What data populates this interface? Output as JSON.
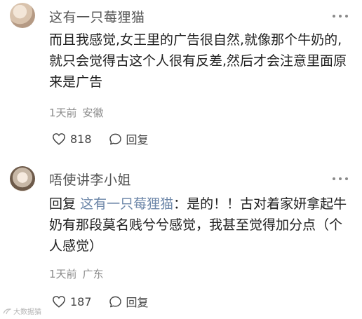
{
  "comments": [
    {
      "username": "这有一只莓狸猫",
      "text": "而且我感觉,女王里的广告很自然,就像那个牛奶的,就只会觉得古这个人很有反差,然后才会注意里面原来是广告",
      "time": "1天前",
      "location": "安徽",
      "likes": "818",
      "reply_label": "回复"
    },
    {
      "username": "唔使讲李小姐",
      "reply_prefix": "回复",
      "reply_target": "这有一只莓狸猫",
      "text": "：是的！！古对着家妍拿起牛奶有那段莫名贱兮兮感觉，我甚至觉得加分点（个人感觉）",
      "time": "1天前",
      "location": "广东",
      "likes": "187",
      "reply_label": "回复"
    }
  ],
  "watermark": "大数据猫",
  "icons": {
    "like": "heart-outline-icon",
    "reply": "speech-bubble-icon",
    "more": "more-dots-icon"
  }
}
